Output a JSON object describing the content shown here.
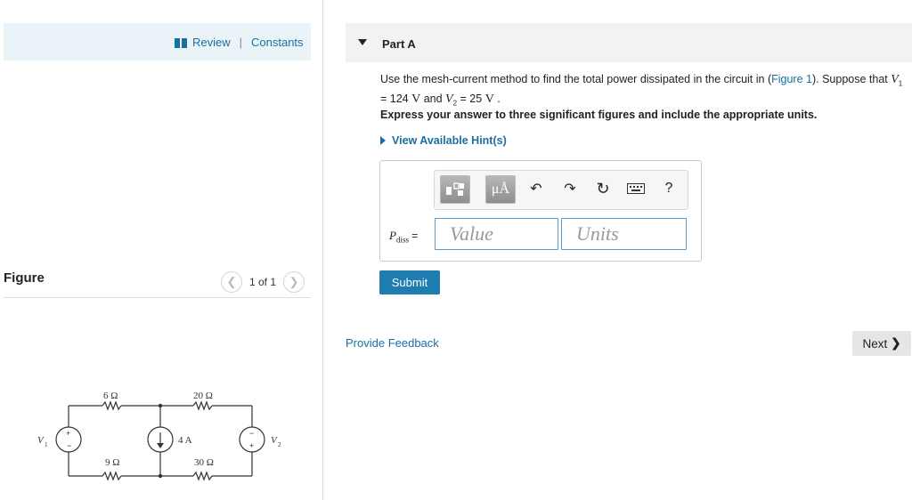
{
  "left_panel": {
    "review_label": "Review",
    "separator": "|",
    "constants_label": "Constants",
    "figure_label": "Figure",
    "pager_text": "1 of 1"
  },
  "circuit": {
    "r_top_left": "6 Ω",
    "r_top_right": "20 Ω",
    "r_bottom_left": "9 Ω",
    "r_bottom_right": "30 Ω",
    "current_source": "4 A",
    "v1_label": "V",
    "v1_sub": "1",
    "v2_label": "V",
    "v2_sub": "2"
  },
  "part": {
    "title": "Part A",
    "q_prefix": "Use the mesh-current method to find the total power dissipated in the circuit in (",
    "q_link": "Figure 1",
    "q_mid": "). Suppose that ",
    "v1_var": "V",
    "v1_sub": "1",
    "q_line2_a": "= 124  ",
    "unit_v": "V",
    "q_and": " and ",
    "v2_var": "V",
    "v2_sub": "2",
    "q_line2_b": " = 25  ",
    "q_end": " .",
    "instruction": "Express your answer to three significant figures and include the appropriate units.",
    "hint_label": "View Available Hint(s)"
  },
  "answer": {
    "var_label": "P",
    "var_sub": "diss",
    "equals": " =",
    "value_placeholder": "Value",
    "units_placeholder": "Units",
    "unit_btn": "μÅ",
    "help_btn": "?"
  },
  "actions": {
    "submit_label": "Submit",
    "feedback_label": "Provide Feedback",
    "next_label": "Next"
  }
}
